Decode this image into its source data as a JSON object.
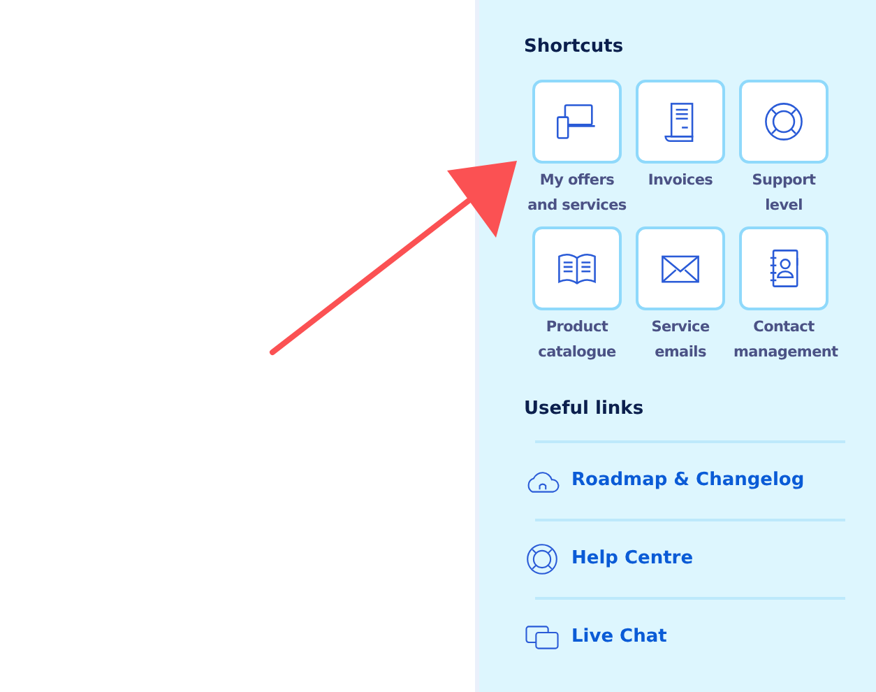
{
  "shortcuts": {
    "title": "Shortcuts",
    "items": [
      {
        "label": "My offers and services",
        "kind": "devices"
      },
      {
        "label": "Invoices",
        "kind": "invoice"
      },
      {
        "label": "Support level",
        "kind": "lifebuoy"
      },
      {
        "label": "Product catalogue",
        "kind": "book"
      },
      {
        "label": "Service emails",
        "kind": "envelope"
      },
      {
        "label": "Contact management",
        "kind": "contacts"
      }
    ]
  },
  "useful_links": {
    "title": "Useful links",
    "items": [
      {
        "label": "Roadmap & Changelog",
        "kind": "cloud"
      },
      {
        "label": "Help Centre",
        "kind": "lifebuoy"
      },
      {
        "label": "Live Chat",
        "kind": "chat"
      }
    ]
  }
}
